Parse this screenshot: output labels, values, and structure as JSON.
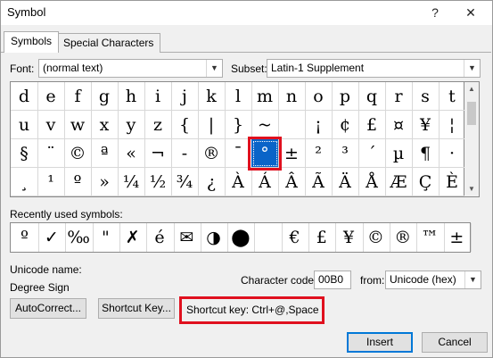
{
  "window": {
    "title": "Symbol",
    "help_label": "?",
    "close_label": "✕"
  },
  "tabs": [
    {
      "label": "Symbols",
      "active": true
    },
    {
      "label": "Special Characters",
      "active": false
    }
  ],
  "font": {
    "label": "Font:",
    "value": "(normal text)"
  },
  "subset": {
    "label": "Subset:",
    "value": "Latin-1 Supplement"
  },
  "symbol_grid": {
    "rows": [
      [
        "d",
        "e",
        "f",
        "g",
        "h",
        "i",
        "j",
        "k",
        "l",
        "m",
        "n",
        "o",
        "p",
        "q",
        "r",
        "s",
        "t"
      ],
      [
        "u",
        "v",
        "w",
        "x",
        "y",
        "z",
        "{",
        "|",
        "}",
        "~",
        "",
        "¡",
        "¢",
        "£",
        "¤",
        "¥",
        "¦"
      ],
      [
        "§",
        "¨",
        "©",
        "ª",
        "«",
        "¬",
        "-",
        "®",
        "¯",
        "°",
        "±",
        "²",
        "³",
        "´",
        "µ",
        "¶",
        "·"
      ],
      [
        "¸",
        "¹",
        "º",
        "»",
        "¼",
        "½",
        "¾",
        "¿",
        "À",
        "Á",
        "Â",
        "Ã",
        "Ä",
        "Å",
        "Æ",
        "Ç",
        "È"
      ]
    ],
    "selected": {
      "row": 2,
      "col": 9
    }
  },
  "recently_used": {
    "label": "Recently used symbols:",
    "symbols": [
      "º",
      "✓",
      "‰",
      "\"",
      "✗",
      "é",
      "✉",
      "◑",
      "⬤",
      "",
      "€",
      "£",
      "¥",
      "©",
      "®",
      "™",
      "±"
    ]
  },
  "unicode_name": {
    "label": "Unicode name:",
    "value": "Degree Sign"
  },
  "character_code": {
    "label": "Character code:",
    "value": "00B0"
  },
  "from": {
    "label": "from:",
    "value": "Unicode (hex)"
  },
  "buttons": {
    "autocorrect": "AutoCorrect...",
    "shortcut_key": "Shortcut Key...",
    "insert": "Insert",
    "cancel": "Cancel"
  },
  "shortcut_text": "Shortcut key: Ctrl+@,Space",
  "highlight_color": "#e0101e",
  "selection_color": "#0a64c8"
}
